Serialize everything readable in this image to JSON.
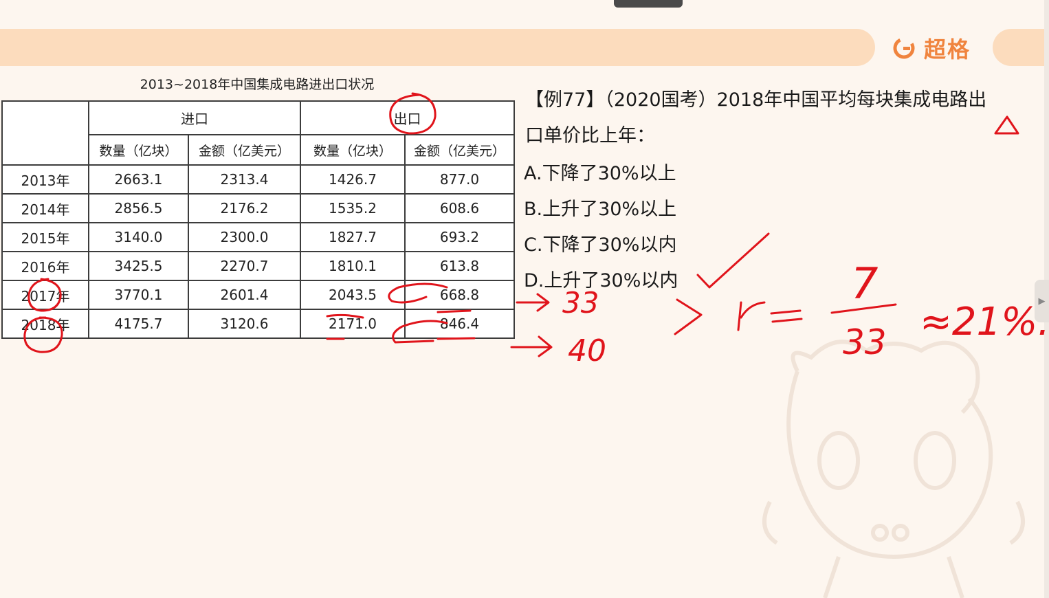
{
  "brand": {
    "name": "超格"
  },
  "table": {
    "title": "2013~2018年中国集成电路进出口状况",
    "import_header": "进口",
    "export_header": "出口",
    "sub_headers": [
      "数量（亿块）",
      "金额（亿美元）",
      "数量（亿块）",
      "金额（亿美元）"
    ],
    "rows": [
      {
        "year": "2013年",
        "imp_qty": "2663.1",
        "imp_amt": "2313.4",
        "exp_qty": "1426.7",
        "exp_amt": "877.0"
      },
      {
        "year": "2014年",
        "imp_qty": "2856.5",
        "imp_amt": "2176.2",
        "exp_qty": "1535.2",
        "exp_amt": "608.6"
      },
      {
        "year": "2015年",
        "imp_qty": "3140.0",
        "imp_amt": "2300.0",
        "exp_qty": "1827.7",
        "exp_amt": "693.2"
      },
      {
        "year": "2016年",
        "imp_qty": "3425.5",
        "imp_amt": "2270.7",
        "exp_qty": "1810.1",
        "exp_amt": "613.8"
      },
      {
        "year": "2017年",
        "imp_qty": "3770.1",
        "imp_amt": "2601.4",
        "exp_qty": "2043.5",
        "exp_amt": "668.8"
      },
      {
        "year": "2018年",
        "imp_qty": "4175.7",
        "imp_amt": "3120.6",
        "exp_qty": "2171.0",
        "exp_amt": "846.4"
      }
    ]
  },
  "question": {
    "line1": "【例77】（2020国考）2018年中国平均每块集成电路出",
    "line2": "口单价比上年：",
    "options": [
      "A.下降了30%以上",
      "B.上升了30%以上",
      "C.下降了30%以内",
      "D.上升了30%以内"
    ]
  },
  "annotations": {
    "arrow_2017": "→33",
    "arrow_2018": "→40",
    "formula_gt": ">",
    "formula_r": "r =",
    "fraction_num": "7",
    "fraction_den": "33",
    "approx": "≈21%.",
    "ink_color": "#e0141b"
  },
  "colors": {
    "banner": "#fcdcbd",
    "brand": "#f0843e",
    "background": "#fdf6ef"
  }
}
